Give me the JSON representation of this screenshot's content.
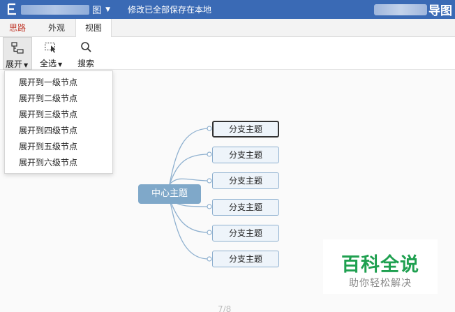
{
  "titlebar": {
    "app_icon": "mindmap-app-icon",
    "doc_title": "图",
    "save_status": "修改已全部保存在本地",
    "brand_suffix": "导图"
  },
  "menu": {
    "tabs": [
      {
        "label": "思路"
      },
      {
        "label": "外观"
      },
      {
        "label": "视图"
      }
    ]
  },
  "toolbar": {
    "expand_label": "展开",
    "select_all_label": "全选",
    "search_label": "搜索"
  },
  "dropdown": {
    "items": [
      "展开到一级节点",
      "展开到二级节点",
      "展开到三级节点",
      "展开到四级节点",
      "展开到五级节点",
      "展开到六级节点"
    ]
  },
  "mindmap": {
    "central": "中心主题",
    "branches": [
      "分支主题",
      "分支主题",
      "分支主题",
      "分支主题",
      "分支主题",
      "分支主题"
    ]
  },
  "watermark": {
    "title": "百科全说",
    "subtitle": "助你轻松解决"
  },
  "page_indicator": "7/8",
  "colors": {
    "titlebar": "#3a6ab5",
    "accent_tab": "#c0392b",
    "central": "#7fa8c9",
    "branch_border": "#8eb0cf",
    "watermark_green": "#1fa050"
  }
}
